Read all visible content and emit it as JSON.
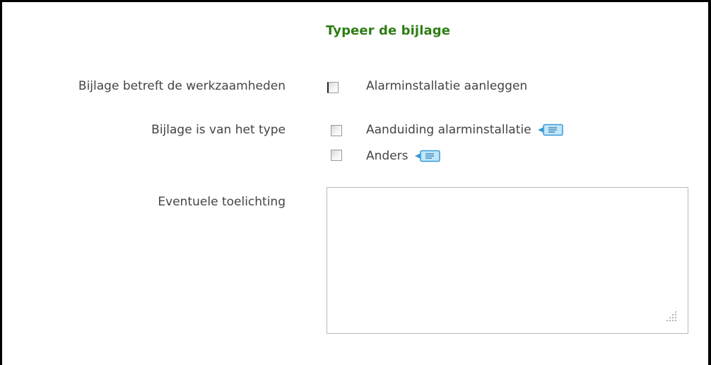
{
  "form": {
    "title": "Typeer de bijlage",
    "work_label": "Bijlage betreft de werkzaamheden",
    "work_option": "Alarminstallatie aanleggen",
    "type_label": "Bijlage is van het type",
    "type_options": [
      {
        "label": "Aanduiding alarminstallatie",
        "checked": false,
        "has_info": true
      },
      {
        "label": "Anders",
        "checked": false,
        "has_info": true
      }
    ],
    "notes_label": "Eventuele toelichting",
    "notes_value": ""
  },
  "colors": {
    "title": "#2e7d12",
    "label_text": "#444444",
    "info_badge": "#bfe6fb",
    "info_badge_border": "#3a9ad6",
    "frame": "#000000"
  },
  "icons": {
    "info": "info-tooltip-icon",
    "resize": "resize-grip-icon"
  }
}
